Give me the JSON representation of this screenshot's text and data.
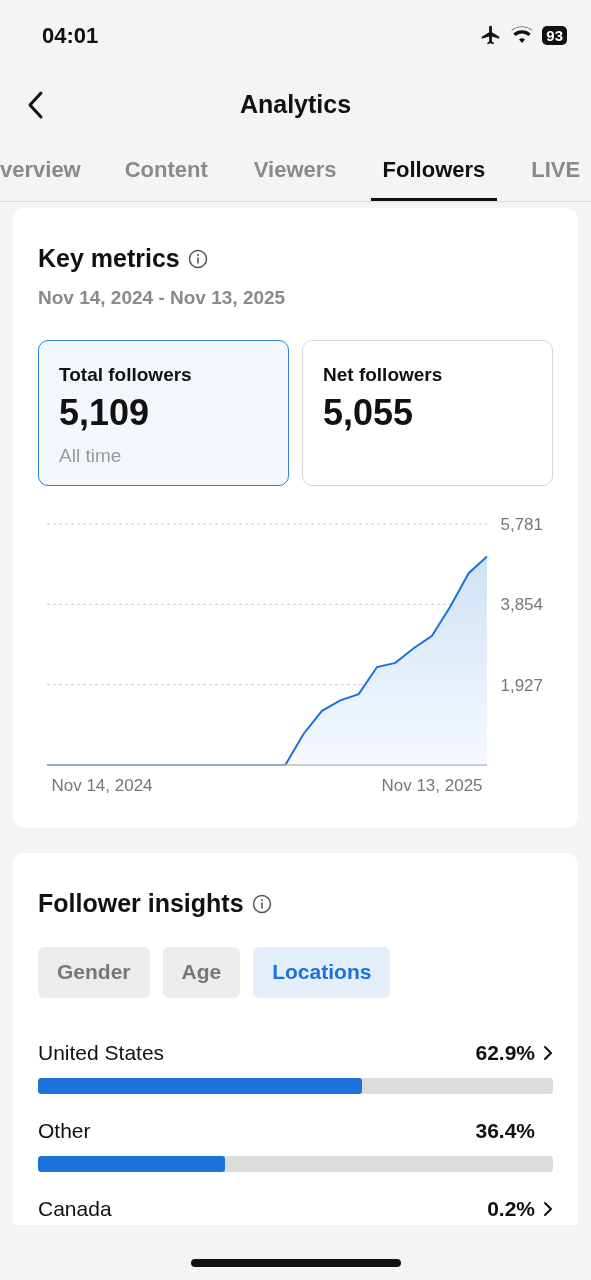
{
  "status_bar": {
    "time": "04:01",
    "battery": "93"
  },
  "header": {
    "title": "Analytics"
  },
  "tabs": [
    {
      "label": "verview",
      "selected": false
    },
    {
      "label": "Content",
      "selected": false
    },
    {
      "label": "Viewers",
      "selected": false
    },
    {
      "label": "Followers",
      "selected": true
    },
    {
      "label": "LIVE",
      "selected": false
    }
  ],
  "key_metrics": {
    "title": "Key metrics",
    "date_range": "Nov 14, 2024 - Nov 13, 2025",
    "cards": [
      {
        "label": "Total followers",
        "value": "5,109",
        "note": "All time",
        "selected": true
      },
      {
        "label": "Net followers",
        "value": "5,055",
        "selected": false
      }
    ],
    "chart_data": {
      "type": "area",
      "categories": [
        null,
        null,
        null,
        "Nov 14, 2024",
        null,
        null,
        null,
        null,
        null,
        null,
        null,
        null,
        null,
        null,
        null,
        null,
        null,
        null,
        null,
        null,
        null,
        "Nov 13, 2025",
        null,
        null,
        null
      ],
      "series": [
        {
          "color": "#1a73d9",
          "values": [
            0,
            0,
            0,
            0,
            0,
            0,
            0,
            0,
            0,
            0,
            0,
            0,
            0,
            0,
            750,
            1300,
            1550,
            1700,
            2350,
            2450,
            2800,
            3100,
            3800,
            4600,
            5000
          ]
        }
      ],
      "ylim": [
        0,
        5781
      ],
      "yticks": [
        {
          "value": 1927,
          "label": "1,927"
        },
        {
          "value": 3854,
          "label": "3,854"
        },
        {
          "value": 5781,
          "label": "5,781"
        }
      ]
    }
  },
  "follower_insights": {
    "title": "Follower insights",
    "filters": [
      {
        "label": "Gender",
        "selected": false
      },
      {
        "label": "Age",
        "selected": false
      },
      {
        "label": "Locations",
        "selected": true
      }
    ],
    "rows": [
      {
        "label": "United States",
        "percent": "62.9%",
        "has_detail": true,
        "level": 0.629
      },
      {
        "label": "Other",
        "percent": "36.4%",
        "has_detail": false,
        "level": 0.364
      },
      {
        "label": "Canada",
        "percent": "0.2%",
        "has_detail": true
      }
    ]
  }
}
